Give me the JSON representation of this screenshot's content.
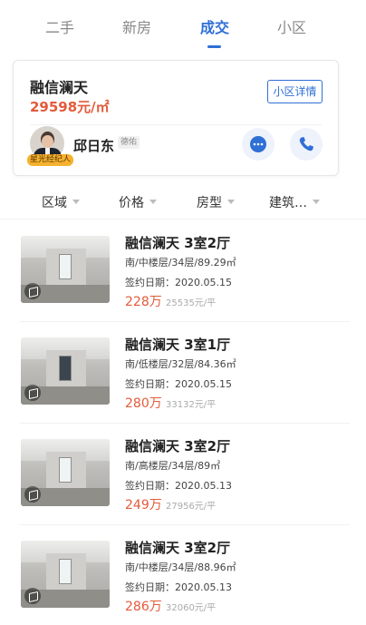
{
  "tabs": [
    {
      "label": "二手",
      "active": false
    },
    {
      "label": "新房",
      "active": false
    },
    {
      "label": "成交",
      "active": true
    },
    {
      "label": "小区",
      "active": false
    }
  ],
  "community": {
    "name": "融信澜天",
    "price": "29598元/㎡",
    "detail_button": "小区详情"
  },
  "agent": {
    "name": "邱日东",
    "company": "德佑",
    "badge": "星光经纪人",
    "chat_icon": "chat-bubble-icon",
    "phone_icon": "phone-icon"
  },
  "filters": [
    {
      "label": "区域"
    },
    {
      "label": "价格"
    },
    {
      "label": "房型"
    },
    {
      "label": "建筑…"
    }
  ],
  "listings": [
    {
      "title": "融信澜天 3室2厅",
      "info": "南/中楼层/34层/89.29㎡",
      "date": "签约日期：2020.05.15",
      "price": "228万",
      "unit_price": "25535元/平",
      "window": "light"
    },
    {
      "title": "融信澜天 3室1厅",
      "info": "南/低楼层/32层/84.36㎡",
      "date": "签约日期：2020.05.15",
      "price": "280万",
      "unit_price": "33132元/平",
      "window": "dark"
    },
    {
      "title": "融信澜天 3室2厅",
      "info": "南/高楼层/34层/89㎡",
      "date": "签约日期：2020.05.13",
      "price": "249万",
      "unit_price": "27956元/平",
      "window": "light"
    },
    {
      "title": "融信澜天 3室2厅",
      "info": "南/中楼层/34层/88.96㎡",
      "date": "签约日期：2020.05.13",
      "price": "286万",
      "unit_price": "32060元/平",
      "window": "light"
    }
  ],
  "colors": {
    "accent": "#2f6fd6",
    "price": "#e35b3b"
  }
}
